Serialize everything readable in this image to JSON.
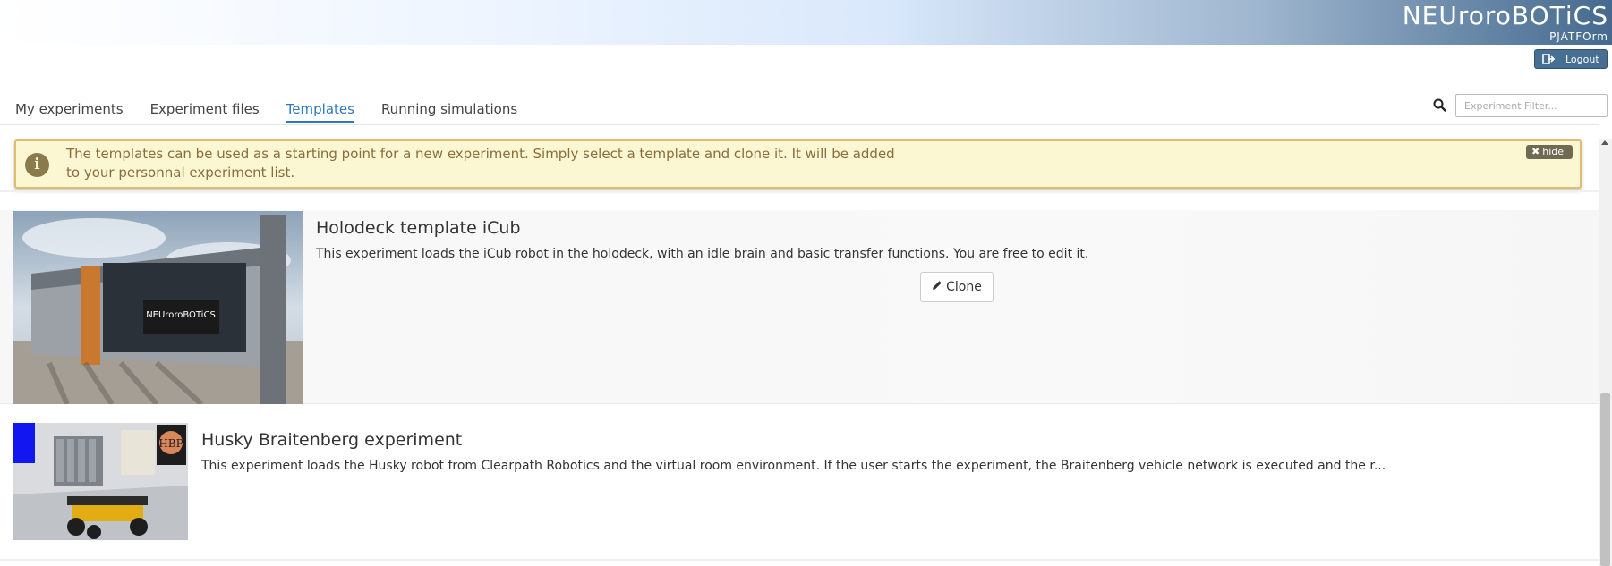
{
  "header": {
    "brand_name": "NEUroroBOTiCS",
    "brand_sub": "PJATFOrm",
    "logout_label": "Logout"
  },
  "nav": {
    "tabs": [
      {
        "label": "My experiments",
        "active": false
      },
      {
        "label": "Experiment files",
        "active": false
      },
      {
        "label": "Templates",
        "active": true
      },
      {
        "label": "Running simulations",
        "active": false
      }
    ],
    "search_icon": "search-icon",
    "filter_placeholder": "Experiment Filter..."
  },
  "alert": {
    "icon": "info-icon",
    "line1": "The templates can be used as a starting point for a new experiment. Simply select a template and clone it. It will be added",
    "line2": "to your personnal experiment list.",
    "hide_label": "hide"
  },
  "experiments": [
    {
      "title": "Holodeck template iCub",
      "description": "This experiment loads the iCub robot in the holodeck, with an idle brain and basic transfer functions. You are free to edit it.",
      "clone_label": "Clone",
      "thumbnail_text": "NEUroroBOTiCS"
    },
    {
      "title": "Husky Braitenberg experiment",
      "description": "This experiment loads the Husky robot from Clearpath Robotics and the virtual room environment. If the user starts the experiment, the Braitenberg vehicle network is executed and the r...",
      "thumbnail_text": "HBP"
    }
  ],
  "colors": {
    "accent": "#2d7ac0",
    "alert_bg": "#fbf7d3",
    "alert_border": "#e1bb6e",
    "alert_text": "#8a6d3b",
    "logout_bg": "#476e93"
  }
}
